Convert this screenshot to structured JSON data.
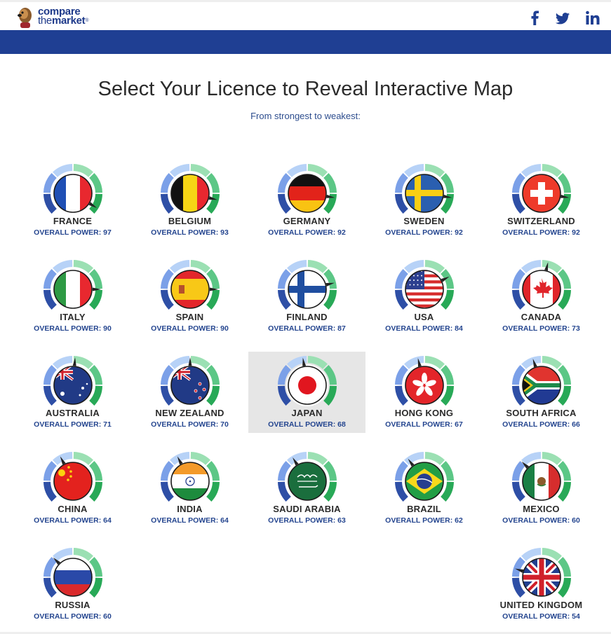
{
  "brand": {
    "line1": "compare",
    "line2_prefix": "the",
    "line2_bold": "market",
    "mark": "®"
  },
  "social": [
    {
      "name": "facebook-icon",
      "label": "f"
    },
    {
      "name": "twitter-icon",
      "label": "twitter"
    },
    {
      "name": "linkedin-icon",
      "label": "in"
    }
  ],
  "title": "Select Your Licence to Reveal Interactive Map",
  "subtitle": "From strongest to weakest:",
  "power_label": "OVERALL POWER: ",
  "colors": {
    "brand_blue": "#1f3f93",
    "text_blue": "#24458f",
    "gauge_dark": "#2e4fa6",
    "gauge_mid": "#7ba0e8",
    "gauge_light": "#b7d2f7",
    "gauge_green_light": "#9be0b3",
    "gauge_green": "#5cc786",
    "gauge_green_dark": "#28a957"
  },
  "selected": "JAPAN",
  "countries": [
    {
      "name": "FRANCE",
      "power": 97,
      "flag": "france"
    },
    {
      "name": "BELGIUM",
      "power": 93,
      "flag": "belgium"
    },
    {
      "name": "GERMANY",
      "power": 92,
      "flag": "germany"
    },
    {
      "name": "SWEDEN",
      "power": 92,
      "flag": "sweden"
    },
    {
      "name": "SWITZERLAND",
      "power": 92,
      "flag": "switzerland"
    },
    {
      "name": "ITALY",
      "power": 90,
      "flag": "italy"
    },
    {
      "name": "SPAIN",
      "power": 90,
      "flag": "spain"
    },
    {
      "name": "FINLAND",
      "power": 87,
      "flag": "finland"
    },
    {
      "name": "USA",
      "power": 84,
      "flag": "usa"
    },
    {
      "name": "CANADA",
      "power": 73,
      "flag": "canada"
    },
    {
      "name": "AUSTRALIA",
      "power": 71,
      "flag": "australia"
    },
    {
      "name": "NEW ZEALAND",
      "power": 70,
      "flag": "newzealand"
    },
    {
      "name": "JAPAN",
      "power": 68,
      "flag": "japan"
    },
    {
      "name": "HONG KONG",
      "power": 67,
      "flag": "hongkong"
    },
    {
      "name": "SOUTH AFRICA",
      "power": 66,
      "flag": "southafrica"
    },
    {
      "name": "CHINA",
      "power": 64,
      "flag": "china"
    },
    {
      "name": "INDIA",
      "power": 64,
      "flag": "india"
    },
    {
      "name": "SAUDI ARABIA",
      "power": 63,
      "flag": "saudiarabia"
    },
    {
      "name": "BRAZIL",
      "power": 62,
      "flag": "brazil"
    },
    {
      "name": "MEXICO",
      "power": 60,
      "flag": "mexico"
    },
    {
      "name": "RUSSIA",
      "power": 60,
      "flag": "russia"
    },
    {
      "name": "UNITED KINGDOM",
      "power": 54,
      "flag": "uk"
    }
  ]
}
